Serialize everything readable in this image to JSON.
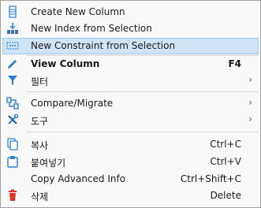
{
  "menu": {
    "items": [
      {
        "label": "Create New Column",
        "icon": "column-icon"
      },
      {
        "label": "New Index from Selection",
        "icon": "index-icon"
      },
      {
        "label": "New Constraint from Selection",
        "icon": "constraint-icon",
        "highlighted": true
      },
      {
        "label": "View Column",
        "shortcut": "F4",
        "icon": "edit-pencil-icon"
      },
      {
        "label": "필터",
        "icon": "filter-icon"
      },
      {
        "label": "Compare/Migrate",
        "icon": "compare-icon"
      },
      {
        "label": "도구",
        "icon": "tools-icon"
      },
      {
        "label": "복사",
        "shortcut": "Ctrl+C",
        "icon": "copy-icon"
      },
      {
        "label": "붙여넣기",
        "shortcut": "Ctrl+V",
        "icon": "paste-icon"
      },
      {
        "label": "Copy Advanced Info",
        "shortcut": "Ctrl+Shift+C"
      },
      {
        "label": "삭제",
        "shortcut": "Delete",
        "icon": "delete-icon"
      }
    ],
    "colors": {
      "highlight": "#cfe4f7",
      "highlight_border": "#99c7ef",
      "accent": "#2a7fd4",
      "delete": "#e0302b"
    }
  }
}
